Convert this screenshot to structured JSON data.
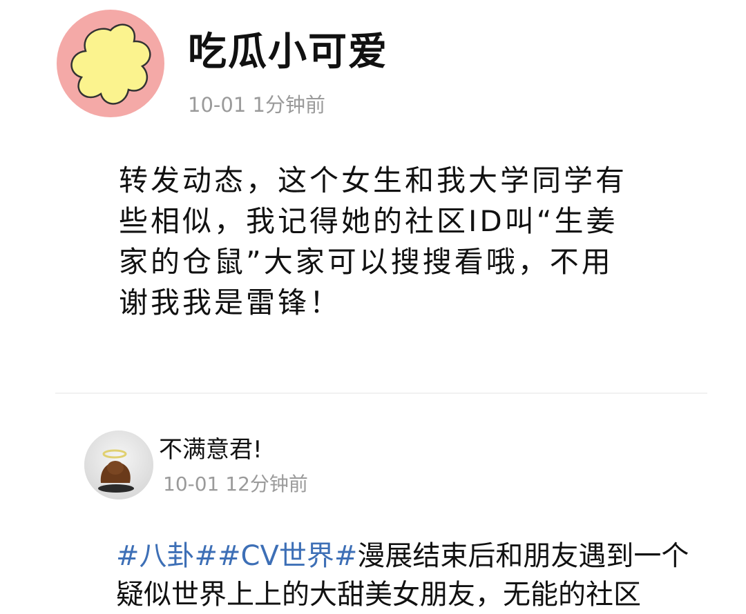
{
  "post1": {
    "username": "吃瓜小可爱",
    "date": "10-01",
    "relative_time": "1分钟前",
    "avatar_icon": "yellow-flower-icon",
    "body_lines": [
      "转发动态，这个女生和我大学同学有",
      "些相似，我记得她的社区ID叫“生姜",
      "家的仓鼠”大家可以搜搜看哦，不用",
      "谢我我是雷锋！"
    ]
  },
  "post2": {
    "username": "不满意君!",
    "date": "10-01",
    "relative_time": "12分钟前",
    "avatar_icon": "angel-halo-figure-icon",
    "tags": [
      "#八卦#",
      "#CV世界#"
    ],
    "body_first_line_rest": "漫展结束后和朋友遇到一个",
    "body_second_line": "疑似世界上上的大甜美女朋友，无能的社区"
  },
  "colors": {
    "tag": "#3d6fb6",
    "meta_text": "#9a9a9a",
    "avatar1_bg": "#f4a9a7",
    "flower": "#fbf38e"
  }
}
